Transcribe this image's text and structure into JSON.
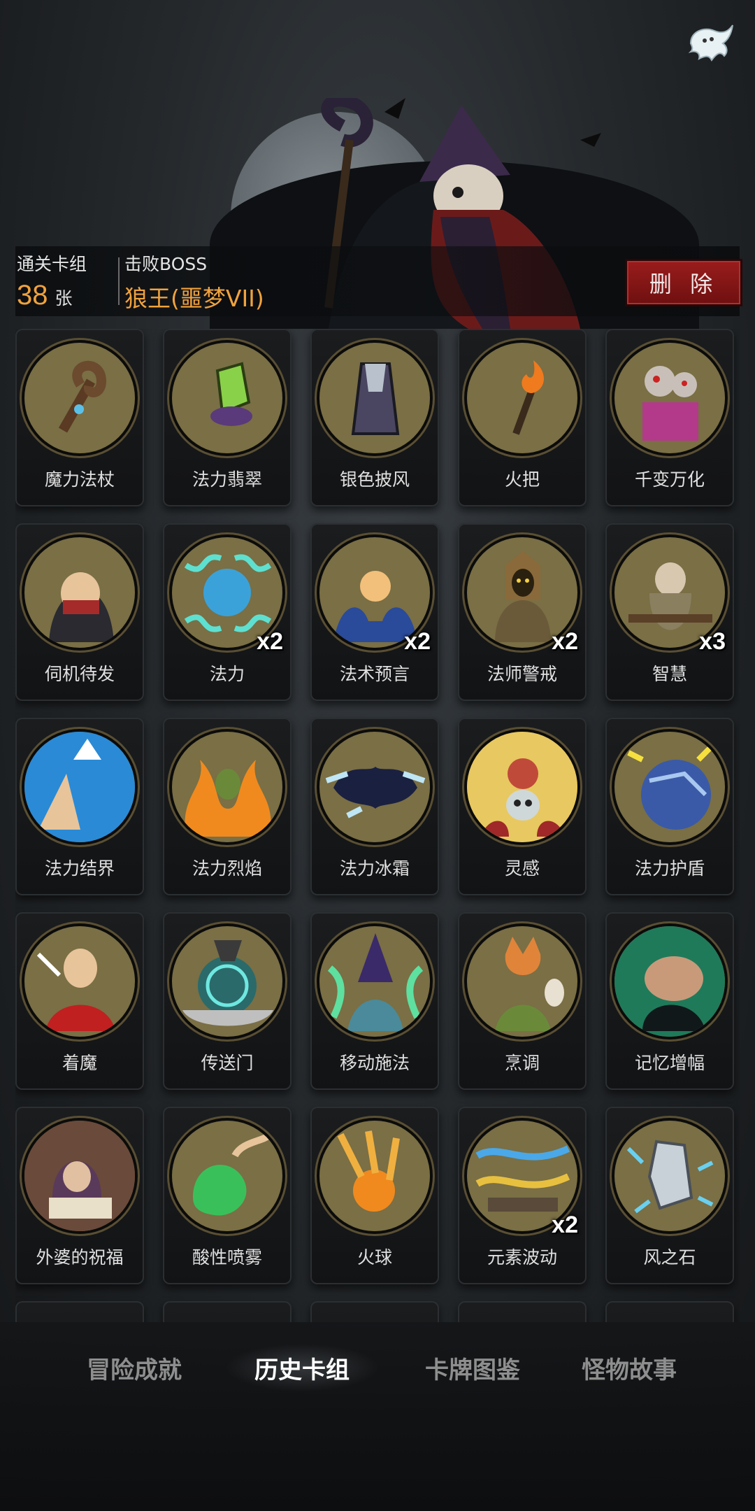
{
  "header": {
    "deck_label": "通关卡组",
    "deck_count": "38",
    "deck_unit": "张",
    "boss_label": "击败BOSS",
    "boss_name": "狼王(噩梦VII)",
    "delete_label": "删 除"
  },
  "cards": [
    {
      "name": "魔力法杖",
      "multiplier": "",
      "icon": "staff-icon",
      "color": "#7a6f45"
    },
    {
      "name": "法力翡翠",
      "multiplier": "",
      "icon": "emerald-icon",
      "color": "#7a6f45"
    },
    {
      "name": "银色披风",
      "multiplier": "",
      "icon": "cloak-icon",
      "color": "#7a6f45"
    },
    {
      "name": "火把",
      "multiplier": "",
      "icon": "torch-icon",
      "color": "#7a6f45"
    },
    {
      "name": "千变万化",
      "multiplier": "",
      "icon": "puppet-icon",
      "color": "#7a6f45"
    },
    {
      "name": "伺机待发",
      "multiplier": "",
      "icon": "rogue-icon",
      "color": "#7a6f45"
    },
    {
      "name": "法力",
      "multiplier": "x2",
      "icon": "mana-orb-icon",
      "color": "#7a6f45"
    },
    {
      "name": "法术预言",
      "multiplier": "x2",
      "icon": "crystal-ball-icon",
      "color": "#7a6f45"
    },
    {
      "name": "法师警戒",
      "multiplier": "x2",
      "icon": "hooded-mage-icon",
      "color": "#7a6f45"
    },
    {
      "name": "智慧",
      "multiplier": "x3",
      "icon": "sage-icon",
      "color": "#7a6f45"
    },
    {
      "name": "法力结界",
      "multiplier": "",
      "icon": "barrier-icon",
      "color": "#7a6f45"
    },
    {
      "name": "法力烈焰",
      "multiplier": "",
      "icon": "flame-zombie-icon",
      "color": "#7a6f45"
    },
    {
      "name": "法力冰霜",
      "multiplier": "",
      "icon": "frost-icon",
      "color": "#7a6f45"
    },
    {
      "name": "灵感",
      "multiplier": "",
      "icon": "skull-brain-icon",
      "color": "#7a6f45"
    },
    {
      "name": "法力护盾",
      "multiplier": "",
      "icon": "shield-orb-icon",
      "color": "#7a6f45"
    },
    {
      "name": "着魔",
      "multiplier": "",
      "icon": "possessed-icon",
      "color": "#7a6f45"
    },
    {
      "name": "传送门",
      "multiplier": "",
      "icon": "portal-icon",
      "color": "#7a6f45"
    },
    {
      "name": "移动施法",
      "multiplier": "",
      "icon": "wizard-icon",
      "color": "#7a6f45"
    },
    {
      "name": "烹调",
      "multiplier": "",
      "icon": "fox-cook-icon",
      "color": "#7a6f45"
    },
    {
      "name": "记忆增幅",
      "multiplier": "",
      "icon": "brain-icon",
      "color": "#7a6f45"
    },
    {
      "name": "外婆的祝福",
      "multiplier": "",
      "icon": "grandma-icon",
      "color": "#7a6f45"
    },
    {
      "name": "酸性喷雾",
      "multiplier": "",
      "icon": "acid-icon",
      "color": "#7a6f45"
    },
    {
      "name": "火球",
      "multiplier": "",
      "icon": "fireball-icon",
      "color": "#7a6f45"
    },
    {
      "name": "元素波动",
      "multiplier": "x2",
      "icon": "elemental-wave-icon",
      "color": "#7a6f45"
    },
    {
      "name": "风之石",
      "multiplier": "",
      "icon": "wind-stone-icon",
      "color": "#7a6f45"
    }
  ],
  "tabs": [
    {
      "label": "冒险成就",
      "active": false
    },
    {
      "label": "历史卡组",
      "active": true
    },
    {
      "label": "卡牌图鉴",
      "active": false
    },
    {
      "label": "怪物故事",
      "active": false
    }
  ]
}
